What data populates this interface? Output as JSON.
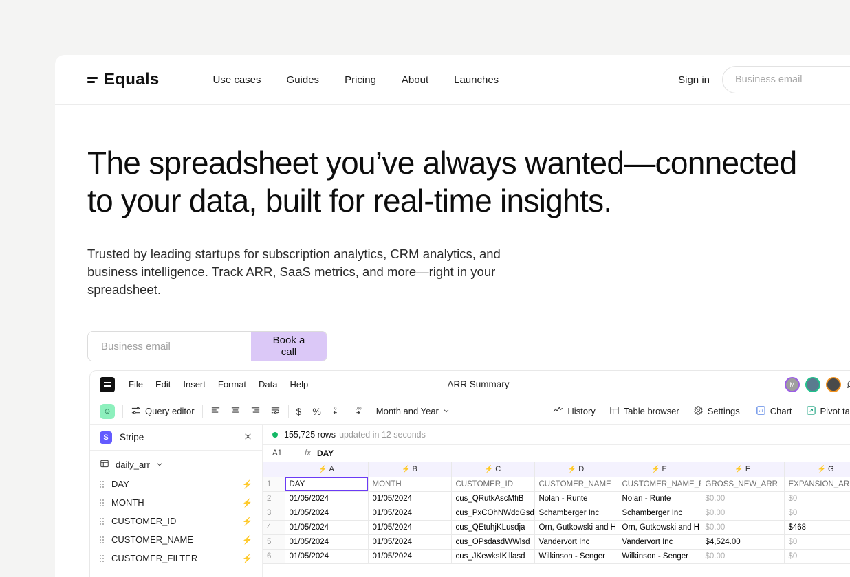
{
  "brand": {
    "logo_text": "Equals",
    "logo_icon": "equals-icon"
  },
  "nav": {
    "links": [
      {
        "label": "Use cases"
      },
      {
        "label": "Guides"
      },
      {
        "label": "Pricing"
      },
      {
        "label": "About"
      },
      {
        "label": "Launches"
      }
    ],
    "signin_label": "Sign in",
    "email_placeholder": "Business email"
  },
  "hero": {
    "heading_line1": "The spreadsheet you’ve always wanted—connected",
    "heading_line2": "to your data, built for real-time insights.",
    "subheading": "Trusted by leading startups for subscription analytics, CRM analytics, and business intelligence. Track ARR, SaaS metrics, and more—right in your spreadsheet.",
    "email_placeholder": "Business email",
    "cta_label": "Book a call"
  },
  "accent_colors": {
    "cta_purple": "#dbc8f7",
    "bolt_purple": "#6b3bf5",
    "stripe_blue": "#635bff",
    "status_green": "#14b866",
    "mint": "#84f7bb",
    "coral": "#fd6a51",
    "yellow": "#fcfd8f",
    "maroon": "#5e1946",
    "peach": "#fdcb8f",
    "deep_blue": "#0b04bc",
    "teal": "#04837f",
    "cyan": "#3dd2e6"
  },
  "app": {
    "menu": [
      {
        "label": "File"
      },
      {
        "label": "Edit"
      },
      {
        "label": "Insert"
      },
      {
        "label": "Format"
      },
      {
        "label": "Data"
      },
      {
        "label": "Help"
      }
    ],
    "doc_title": "ARR Summary",
    "avatars": [
      {
        "initial": "M",
        "name": "avatar-m"
      },
      {
        "initial": "",
        "name": "avatar-photo-1"
      },
      {
        "initial": "",
        "name": "avatar-photo-2"
      }
    ],
    "toolbar": {
      "query_editor_label": "Query editor",
      "number_format_label": "Month and Year",
      "history_label": "History",
      "table_browser_label": "Table browser",
      "settings_label": "Settings",
      "chart_label": "Chart",
      "pivot_label": "Pivot tabl"
    },
    "sidebar": {
      "connection": "Stripe",
      "table_name": "daily_arr",
      "fields": [
        {
          "label": "DAY"
        },
        {
          "label": "MONTH"
        },
        {
          "label": "CUSTOMER_ID"
        },
        {
          "label": "CUSTOMER_NAME"
        },
        {
          "label": "CUSTOMER_FILTER"
        }
      ]
    },
    "status": {
      "rows": "155,725 rows",
      "updated": "updated in 12 seconds"
    },
    "formula": {
      "cell_ref": "A1",
      "fx_label": "fx",
      "value": "DAY"
    }
  },
  "chart_data": {
    "type": "table",
    "title": "ARR Summary — daily_arr",
    "columns": [
      "A",
      "B",
      "C",
      "D",
      "E",
      "F",
      "G"
    ],
    "headers": [
      "DAY",
      "MONTH",
      "CUSTOMER_ID",
      "CUSTOMER_NAME",
      "CUSTOMER_NAME_F",
      "GROSS_NEW_ARR",
      "EXPANSION_ARR"
    ],
    "row_numbers": [
      1,
      2,
      3,
      4,
      5,
      6
    ],
    "rows": [
      [
        "DAY",
        "MONTH",
        "CUSTOMER_ID",
        "CUSTOMER_NAME",
        "CUSTOMER_NAME_F",
        "GROSS_NEW_ARR",
        "EXPANSION_ARR"
      ],
      [
        "01/05/2024",
        "01/05/2024",
        "cus_QRutkAscMfiB",
        "Nolan - Runte",
        "Nolan - Runte",
        "$0.00",
        "$0"
      ],
      [
        "01/05/2024",
        "01/05/2024",
        "cus_PxCOhNWddGsd",
        "Schamberger Inc",
        "Schamberger Inc",
        "$0.00",
        "$0"
      ],
      [
        "01/05/2024",
        "01/05/2024",
        "cus_QEtuhjKLusdja",
        "Orn, Gutkowski and H",
        "Orn, Gutkowski and H",
        "$0.00",
        "$468"
      ],
      [
        "01/05/2024",
        "01/05/2024",
        "cus_OPsdasdWWlsd",
        "Vandervort Inc",
        "Vandervort Inc",
        "$4,524.00",
        "$0"
      ],
      [
        "01/05/2024",
        "01/05/2024",
        "cus_JKewksIKlllasd",
        "Wilkinson - Senger",
        "Wilkinson - Senger",
        "$0.00",
        "$0"
      ]
    ]
  }
}
